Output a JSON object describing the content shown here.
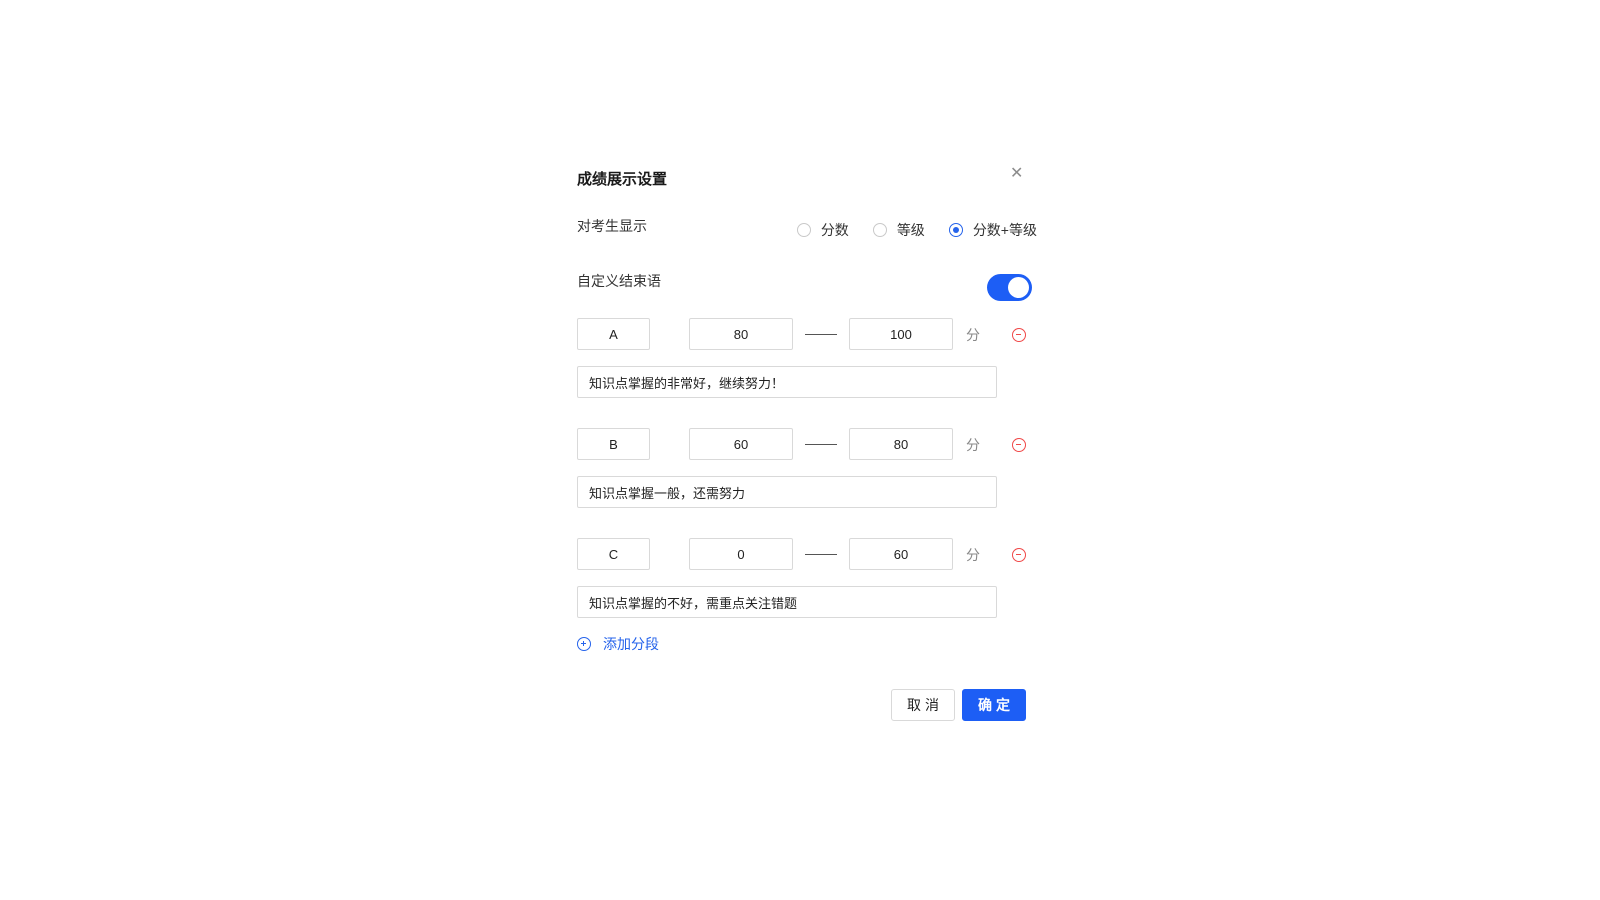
{
  "dialog": {
    "title": "成绩展示设置",
    "close_icon": "close-icon"
  },
  "display": {
    "label": "对考生显示",
    "options": [
      {
        "label": "分数",
        "checked": false
      },
      {
        "label": "等级",
        "checked": false
      },
      {
        "label": "分数+等级",
        "checked": true
      }
    ]
  },
  "custom_ending": {
    "label": "自定义结束语",
    "enabled": true
  },
  "segments": [
    {
      "grade": "A",
      "min": "80",
      "max": "100",
      "unit": "分",
      "message": "知识点掌握的非常好，继续努力！"
    },
    {
      "grade": "B",
      "min": "60",
      "max": "80",
      "unit": "分",
      "message": "知识点掌握一般，还需努力"
    },
    {
      "grade": "C",
      "min": "0",
      "max": "60",
      "unit": "分",
      "message": "知识点掌握的不好，需重点关注错题"
    }
  ],
  "add_segment": {
    "label": "添加分段"
  },
  "footer": {
    "cancel_label": "取消",
    "ok_label": "确定"
  },
  "colors": {
    "primary": "#1d5ef5",
    "danger": "#f04848",
    "border": "#d9d9d9"
  }
}
